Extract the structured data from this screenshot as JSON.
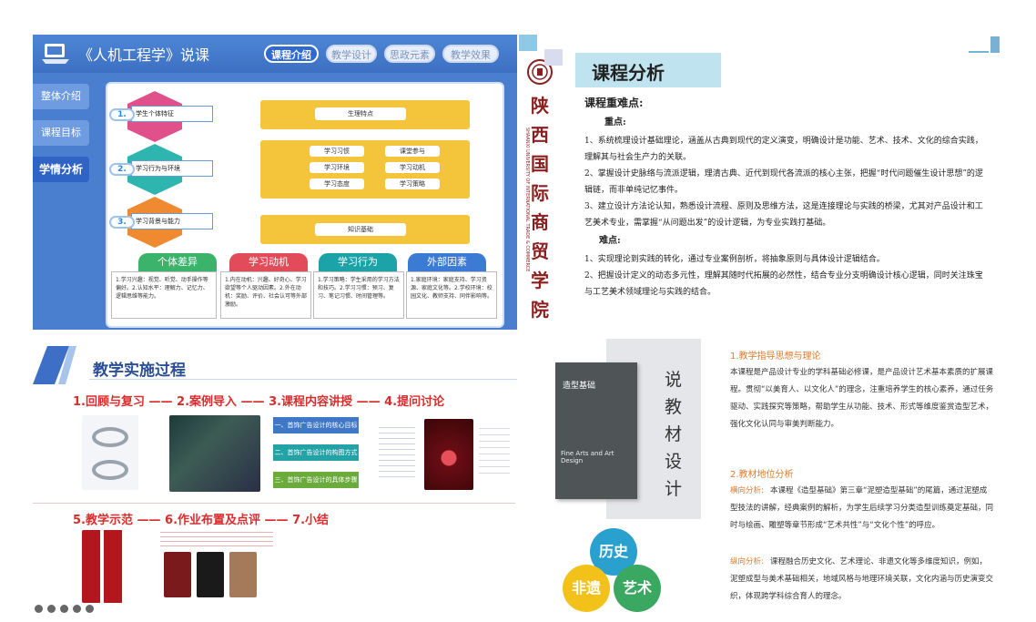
{
  "panel1": {
    "title": "《人机工程学》说课",
    "tabs": [
      "课程介绍",
      "教学设计",
      "思政元素",
      "教学效果"
    ],
    "side_tabs": [
      "整体介绍",
      "课程目标",
      "学情分析"
    ],
    "rows": [
      {
        "num": "1.",
        "label": "学生个体特征",
        "bar": "生理特点"
      },
      {
        "num": "2.",
        "label": "学习行为与环境",
        "tags": [
          "学习习惯",
          "学习环境",
          "学习态度",
          "课堂参与",
          "学习动机",
          "学习策略"
        ]
      },
      {
        "num": "3.",
        "label": "学习背景与能力",
        "bar": "知识基础"
      }
    ],
    "categories": [
      {
        "name": "个体差异",
        "color": "#3bb36a",
        "text": "1.学习兴趣：视觉、听觉、动手操作等偏好。2.认知水平：理解力、记忆力、逻辑思维等能力。"
      },
      {
        "name": "学习动机",
        "color": "#e24b5a",
        "text": "1.内在动机：兴趣、好奇心、学习欲望等个人驱动因素。2.外在动机：奖励、评价、社会认可等外部激励。"
      },
      {
        "name": "学习行为",
        "color": "#1ba3a8",
        "text": "1.学习策略：学生采用的学习方法和技巧。2.学习习惯：预习、复习、笔记习惯、时间管理等。"
      },
      {
        "name": "外部因素",
        "color": "#3b7bd4",
        "text": "1.家庭环境：家庭支持、学习资源、家庭文化等。2.学校环境：校园文化、教师支持、同伴影响等。"
      }
    ],
    "seal_chars": [
      "陕",
      "西",
      "国",
      "际",
      "商",
      "贸",
      "学",
      "院"
    ],
    "seal_english": "SHAANXI UNIVERSITY OF INTERNATIONAL TRADE & COMMERCE"
  },
  "panel2": {
    "header": "课程分析",
    "subtitle": "课程重难点:",
    "key_label": "重点:",
    "key_points": [
      "1、系统梳理设计基础理论，涵盖从古典到现代的定义演变，明确设计是功能、艺术、技术、文化的综合实践，理解其与社会生产力的关联。",
      "2、掌握设计史脉络与流派逻辑，理清古典、近代到现代各流派的核心主张，把握“时代问题催生设计思想”的逻辑链，而非单纯记忆事件。",
      "3、建立设计方法论认知，熟悉设计流程、原则及思维方法，这是连接理论与实践的桥梁，尤其对产品设计和工艺美术专业，需掌握“从问题出发”的设计逻辑，为专业实践打基础。"
    ],
    "difficult_label": "难点:",
    "difficult_points": [
      "1、实现理论到实践的转化，通过专业案例剖析，将抽象原则与具体设计逻辑结合。",
      "2、把握设计定义的动态多元性，理解其随时代拓展的必然性，结合专业分支明确设计核心逻辑，同时关注珠宝与工艺美术领域理论与实践的结合。"
    ]
  },
  "panel3": {
    "title": "教学实施过程",
    "steps_row1": "1.回顾与复习 —— 2.案例导入 —— 3.课程内容讲授 —— 4.提问讨论",
    "steps_row2": "5.教学示范 —— 6.作业布置及点评 —— 7.小结",
    "lesson_buttons": [
      "一、首饰广告设计的核心目标",
      "二、首饰广告设计的构图方式",
      "三、首饰广告设计的具体步骤"
    ]
  },
  "panel4": {
    "vertical_title": [
      "说",
      "教",
      "材",
      "设",
      "计"
    ],
    "book_title": "造型基础",
    "book_en": "Fine Arts and Art Design",
    "section1": "1.教学指导思想与理论",
    "section1_text": "本课程是产品设计专业的学科基础必修课，是产品设计艺术基本素质的扩展课程。贯彻“以美育人、以文化人”的理念，注重培养学生的核心素养，通过任务驱动、实践探究等策略，帮助学生从功能、技术、形式等维度鉴赏造型艺术，强化文化认同与审美判断能力。",
    "section2": "2.教材地位分析",
    "horizontal_label": "横向分析:",
    "horizontal_text": "本课程《造型基础》第三章“泥塑造型基础”的尾篇，通过泥塑成型技法的讲解，经典案例的解析，为学生后续学习分类造型训练奠定基础，同时与绘画、雕塑等章节形成“艺术共性”与“文化个性”的呼应。",
    "vertical_label": "纵向分析:",
    "vertical_text": "课程融合历史文化、艺术理论、非遗文化等多维度知识，例如，泥塑成型与美术基础相关，地域风格与地理环境关联，文化内涵与历史演变交织，体现跨学科综合育人的理念。",
    "circles": [
      "历史",
      "非遗",
      "艺术"
    ]
  }
}
